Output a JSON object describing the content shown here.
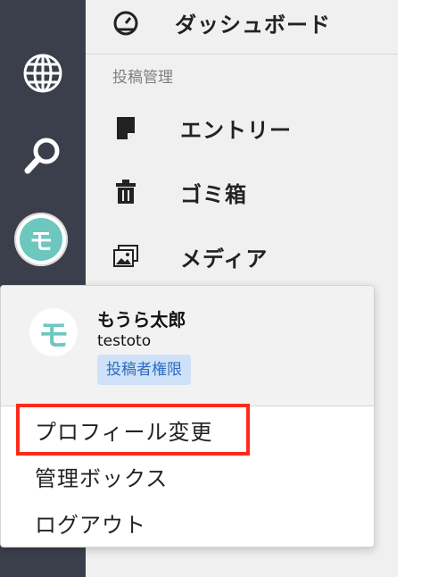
{
  "rail": {
    "icons": [
      "globe-icon",
      "search-icon"
    ],
    "avatar_initial": "モ"
  },
  "menu": {
    "dashboard_label": "ダッシュボード",
    "section_label": "投稿管理",
    "items": [
      {
        "label": "エントリー",
        "icon": "document-icon"
      },
      {
        "label": "ゴミ箱",
        "icon": "trash-icon"
      },
      {
        "label": "メディア",
        "icon": "media-icon"
      }
    ]
  },
  "popup": {
    "avatar_initial": "モ",
    "user_name": "もうら太郎",
    "user_id": "testoto",
    "role": "投稿者権限",
    "items": [
      {
        "label": "プロフィール変更"
      },
      {
        "label": "管理ボックス"
      },
      {
        "label": "ログアウト"
      }
    ]
  },
  "colors": {
    "rail_bg": "#3b3f4c",
    "menu_bg": "#f0f0f0",
    "avatar_teal": "#6cc7bf",
    "badge_bg": "#cfe1f8",
    "badge_text": "#2d6cc0",
    "highlight_red": "#ff2a1a"
  }
}
